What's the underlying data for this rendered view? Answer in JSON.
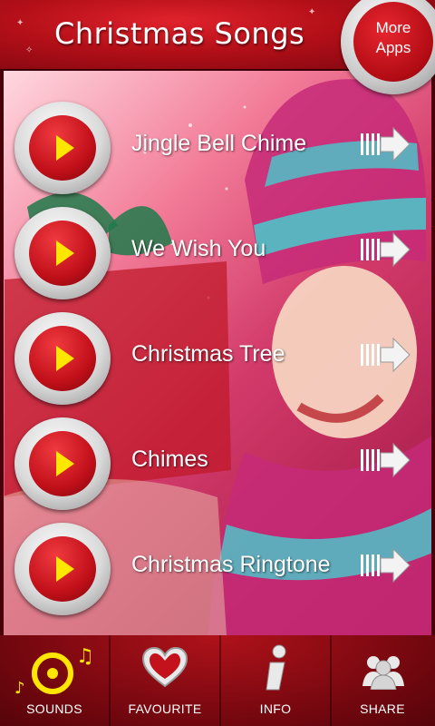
{
  "header": {
    "title": "Christmas Songs"
  },
  "more_apps": {
    "line1": "More",
    "line2": "Apps"
  },
  "songs": [
    {
      "title": "Jingle Bell Chime"
    },
    {
      "title": "We Wish You"
    },
    {
      "title": "Christmas Tree"
    },
    {
      "title": "Chimes"
    },
    {
      "title": "Christmas Ringtone"
    }
  ],
  "tabs": [
    {
      "label": "SOUNDS",
      "icon": "sounds-icon"
    },
    {
      "label": "FAVOURITE",
      "icon": "heart-icon"
    },
    {
      "label": "INFO",
      "icon": "info-icon"
    },
    {
      "label": "SHARE",
      "icon": "share-icon"
    }
  ],
  "colors": {
    "accent_red": "#c2101a",
    "play_triangle": "#ffe600",
    "active_tab_icon": "#ffe600"
  }
}
